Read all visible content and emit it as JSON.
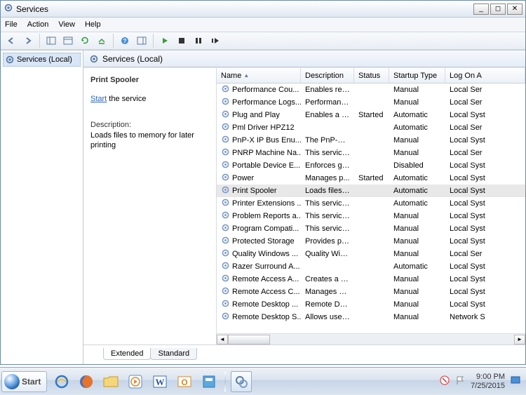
{
  "window": {
    "title": "Services"
  },
  "menu": {
    "file": "File",
    "action": "Action",
    "view": "View",
    "help": "Help"
  },
  "tree": {
    "root": "Services (Local)"
  },
  "header": {
    "label": "Services (Local)"
  },
  "detail": {
    "title": "Print Spooler",
    "start_link": "Start",
    "start_rest": " the service",
    "desc_label": "Description:",
    "desc_body": "Loads files to memory for later printing"
  },
  "columns": {
    "name": "Name",
    "description": "Description",
    "status": "Status",
    "startup": "Startup Type",
    "logon": "Log On A"
  },
  "tabs": {
    "extended": "Extended",
    "standard": "Standard"
  },
  "taskbar": {
    "start": "Start",
    "time": "9:00 PM",
    "date": "7/25/2015"
  },
  "services": [
    {
      "name": "Performance Cou...",
      "desc": "Enables rem...",
      "status": "",
      "startup": "Manual",
      "logon": "Local Ser"
    },
    {
      "name": "Performance Logs...",
      "desc": "Performanc...",
      "status": "",
      "startup": "Manual",
      "logon": "Local Ser"
    },
    {
      "name": "Plug and Play",
      "desc": "Enables a c...",
      "status": "Started",
      "startup": "Automatic",
      "logon": "Local Syst"
    },
    {
      "name": "Pml Driver HPZ12",
      "desc": "",
      "status": "",
      "startup": "Automatic",
      "logon": "Local Ser"
    },
    {
      "name": "PnP-X IP Bus Enu...",
      "desc": "The PnP-X ...",
      "status": "",
      "startup": "Manual",
      "logon": "Local Syst"
    },
    {
      "name": "PNRP Machine Na...",
      "desc": "This service ...",
      "status": "",
      "startup": "Manual",
      "logon": "Local Ser"
    },
    {
      "name": "Portable Device E...",
      "desc": "Enforces gr...",
      "status": "",
      "startup": "Disabled",
      "logon": "Local Syst"
    },
    {
      "name": "Power",
      "desc": "Manages p...",
      "status": "Started",
      "startup": "Automatic",
      "logon": "Local Syst"
    },
    {
      "name": "Print Spooler",
      "desc": "Loads files t...",
      "status": "",
      "startup": "Automatic",
      "logon": "Local Syst",
      "selected": true
    },
    {
      "name": "Printer Extensions ...",
      "desc": "This service ...",
      "status": "",
      "startup": "Automatic",
      "logon": "Local Syst"
    },
    {
      "name": "Problem Reports a...",
      "desc": "This service ...",
      "status": "",
      "startup": "Manual",
      "logon": "Local Syst"
    },
    {
      "name": "Program Compati...",
      "desc": "This service ...",
      "status": "",
      "startup": "Manual",
      "logon": "Local Syst"
    },
    {
      "name": "Protected Storage",
      "desc": "Provides pr...",
      "status": "",
      "startup": "Manual",
      "logon": "Local Syst"
    },
    {
      "name": "Quality Windows ...",
      "desc": "Quality Win...",
      "status": "",
      "startup": "Manual",
      "logon": "Local Ser"
    },
    {
      "name": "Razer Surround A...",
      "desc": "",
      "status": "",
      "startup": "Automatic",
      "logon": "Local Syst"
    },
    {
      "name": "Remote Access A...",
      "desc": "Creates a co...",
      "status": "",
      "startup": "Manual",
      "logon": "Local Syst"
    },
    {
      "name": "Remote Access C...",
      "desc": "Manages di...",
      "status": "",
      "startup": "Manual",
      "logon": "Local Syst"
    },
    {
      "name": "Remote Desktop ...",
      "desc": "Remote Des...",
      "status": "",
      "startup": "Manual",
      "logon": "Local Syst"
    },
    {
      "name": "Remote Desktop S...",
      "desc": "Allows user...",
      "status": "",
      "startup": "Manual",
      "logon": "Network S"
    }
  ]
}
